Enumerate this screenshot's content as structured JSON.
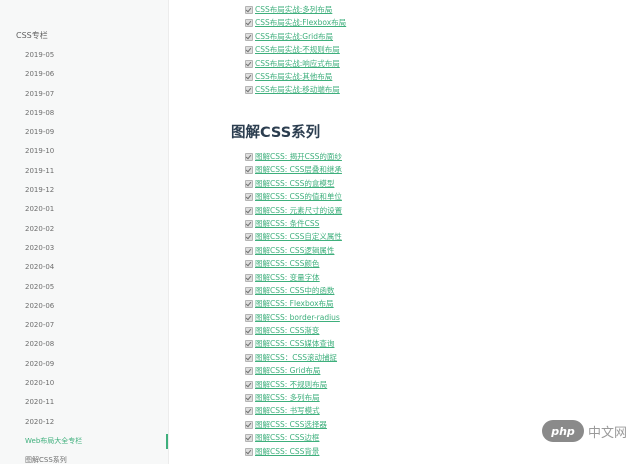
{
  "sidebar": {
    "title": "CSS专栏",
    "items": [
      {
        "label": "2019-05"
      },
      {
        "label": "2019-06"
      },
      {
        "label": "2019-07"
      },
      {
        "label": "2019-08"
      },
      {
        "label": "2019-09"
      },
      {
        "label": "2019-10"
      },
      {
        "label": "2019-11"
      },
      {
        "label": "2019-12"
      },
      {
        "label": "2020-01"
      },
      {
        "label": "2020-02"
      },
      {
        "label": "2020-03"
      },
      {
        "label": "2020-04"
      },
      {
        "label": "2020-05"
      },
      {
        "label": "2020-06"
      },
      {
        "label": "2020-07"
      },
      {
        "label": "2020-08"
      },
      {
        "label": "2020-09"
      },
      {
        "label": "2020-10"
      },
      {
        "label": "2020-11"
      },
      {
        "label": "2020-12"
      },
      {
        "label": "Web布局大全专栏",
        "active": true
      },
      {
        "label": "图解CSS系列"
      }
    ]
  },
  "layout_links": [
    "CSS布局实战:多列布局",
    "CSS布局实战:Flexbox布局",
    "CSS布局实战:Grid布局",
    "CSS布局实战:不规则布局",
    "CSS布局实战:响应式布局",
    "CSS布局实战:其他布局",
    "CSS布局实战:移动端布局"
  ],
  "section": {
    "heading": "图解CSS系列",
    "links": [
      "图解CSS: 揭开CSS的面纱",
      "图解CSS: CSS层叠和继承",
      "图解CSS: CSS的盒模型",
      "图解CSS: CSS的值和单位",
      "图解CSS: 元素尺寸的设置",
      "图解CSS: 条件CSS",
      "图解CSS: CSS自定义属性",
      "图解CSS: CSS逻辑属性",
      "图解CSS: CSS颜色",
      "图解CSS: 变量字体",
      "图解CSS: CSS中的函数",
      "图解CSS: Flexbox布局",
      "图解CSS: border-radius",
      "图解CSS: CSS渐变",
      "图解CSS: CSS媒体查询",
      "图解CSS：CSS滚动捕捉",
      "图解CSS: Grid布局",
      "图解CSS: 不规则布局",
      "图解CSS: 多列布局",
      "图解CSS: 书写模式",
      "图解CSS: CSS选择器",
      "图解CSS: CSS边框",
      "图解CSS: CSS背景"
    ]
  },
  "watermark": {
    "badge": "php",
    "text": "中文网"
  },
  "colors": {
    "link": "#3eaf7c",
    "heading": "#2c3e50",
    "sidebar_bg": "#f7f8f8"
  }
}
